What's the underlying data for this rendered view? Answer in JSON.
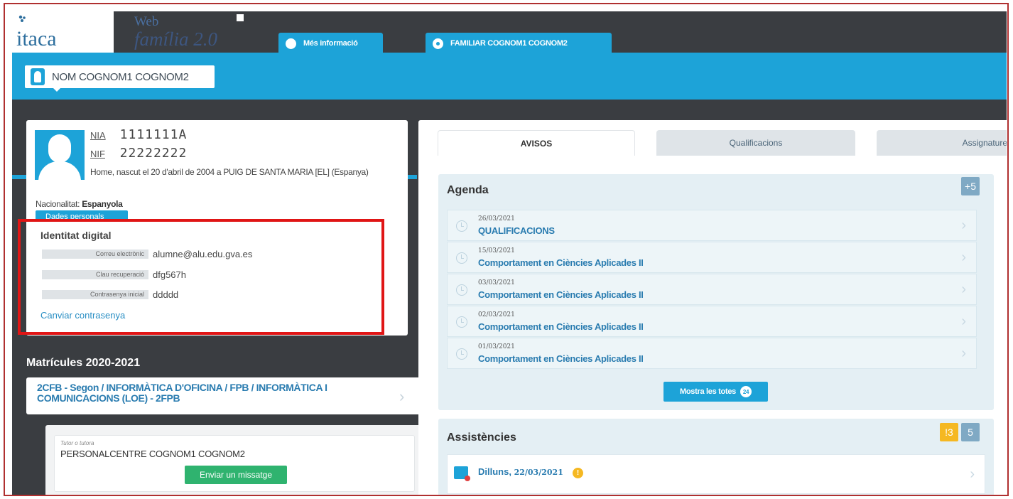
{
  "header": {
    "logo": "itaca",
    "web_label": "Web",
    "familia_label": "família 2.0",
    "info_tab": "Més informació",
    "family_tab": "FAMILIAR COGNOM1 COGNOM2"
  },
  "student": {
    "selector_name": "NOM COGNOM1 COGNOM2"
  },
  "profile": {
    "nia_label": "NIA",
    "nia": "1111111A",
    "nif_label": "NIF",
    "nif": "22222222",
    "birth": "Home, nascut el 20 d'abril de 2004 a PUIG DE SANTA MARIA [EL] (Espanya)",
    "nationality_label": "Nacionalitat:",
    "nationality": "Espanyola",
    "personal_data_button": "Dades personals"
  },
  "digital_identity": {
    "title": "Identitat digital",
    "rows": [
      {
        "key": "Correu electrònic",
        "value": "alumne@alu.edu.gva.es"
      },
      {
        "key": "Clau recuperació",
        "value": "dfg567h"
      },
      {
        "key": "Contrasenya inicial",
        "value": "ddddd"
      }
    ],
    "change_password": "Canviar contrasenya"
  },
  "enrollments": {
    "title": "Matrícules 2020-2021",
    "course": "2CFB - Segon / INFORMÀTICA D'OFICINA / FPB / INFORMÀTICA I COMUNICACIONS (LOE) - 2FPB",
    "tutor_label": "Tutor o tutora",
    "tutor_name": "PERSONALCENTRE COGNOM1 COGNOM2",
    "send_message": "Enviar un missatge"
  },
  "tabs": [
    "AVISOS",
    "Qualificacions",
    "Assignatures"
  ],
  "agenda": {
    "title": "Agenda",
    "badge": "+5",
    "items": [
      {
        "date": "26/03/2021",
        "title": "QUALIFICACIONS"
      },
      {
        "date": "15/03/2021",
        "title": "Comportament en Ciències Aplicades II"
      },
      {
        "date": "03/03/2021",
        "title": "Comportament en Ciències Aplicades II"
      },
      {
        "date": "02/03/2021",
        "title": "Comportament en Ciències Aplicades II"
      },
      {
        "date": "01/03/2021",
        "title": "Comportament en Ciències Aplicades II"
      }
    ],
    "show_all": "Mostra les totes",
    "show_all_count": "24"
  },
  "attendance": {
    "title": "Assistències",
    "badge_warning": "!3",
    "badge_count": "5",
    "item_day": "Dilluns,",
    "item_date": "22/03/2021",
    "item_flag": "!"
  },
  "colors": {
    "accent": "#1da3d8",
    "dark": "#3a3d41",
    "link": "#2a7cb0",
    "success": "#2fb36f",
    "warning": "#f5b822",
    "highlight": "#e01515"
  }
}
